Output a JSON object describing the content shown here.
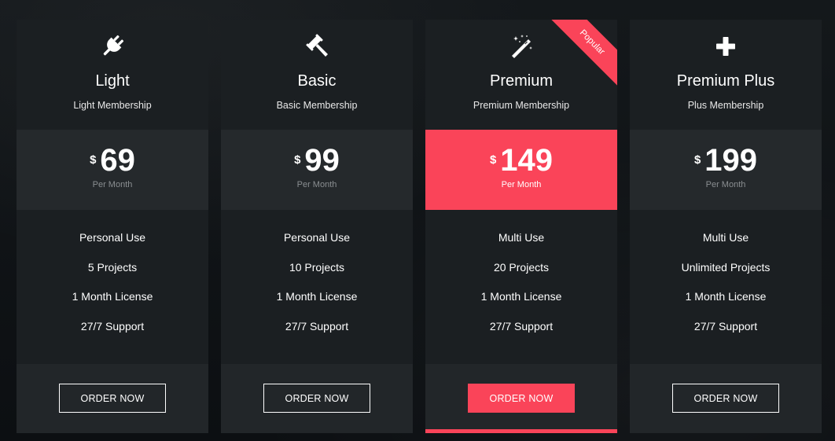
{
  "colors": {
    "accent": "#fa4459",
    "card": "#1b1f22",
    "price_box": "#25292c",
    "footer": "#222629",
    "background": "#0e1215"
  },
  "plans": [
    {
      "icon": "plug-icon",
      "name": "Light",
      "subtitle": "Light Membership",
      "currency": "$",
      "price": "69",
      "period": "Per Month",
      "features": [
        "Personal Use",
        "5 Projects",
        "1 Month License",
        "27/7 Support"
      ],
      "button": "ORDER NOW",
      "featured": false
    },
    {
      "icon": "gavel-icon",
      "name": "Basic",
      "subtitle": "Basic Membership",
      "currency": "$",
      "price": "99",
      "period": "Per Month",
      "features": [
        "Personal Use",
        "10 Projects",
        "1 Month License",
        "27/7 Support"
      ],
      "button": "ORDER NOW",
      "featured": false
    },
    {
      "icon": "magic-wand-icon",
      "name": "Premium",
      "subtitle": "Premium Membership",
      "currency": "$",
      "price": "149",
      "period": "Per Month",
      "features": [
        "Multi Use",
        "20 Projects",
        "1 Month License",
        "27/7 Support"
      ],
      "button": "ORDER NOW",
      "featured": true,
      "ribbon": "Popular"
    },
    {
      "icon": "plus-icon",
      "name": "Premium Plus",
      "subtitle": "Plus Membership",
      "currency": "$",
      "price": "199",
      "period": "Per Month",
      "features": [
        "Multi Use",
        "Unlimited Projects",
        "1 Month License",
        "27/7 Support"
      ],
      "button": "ORDER NOW",
      "featured": false
    }
  ]
}
